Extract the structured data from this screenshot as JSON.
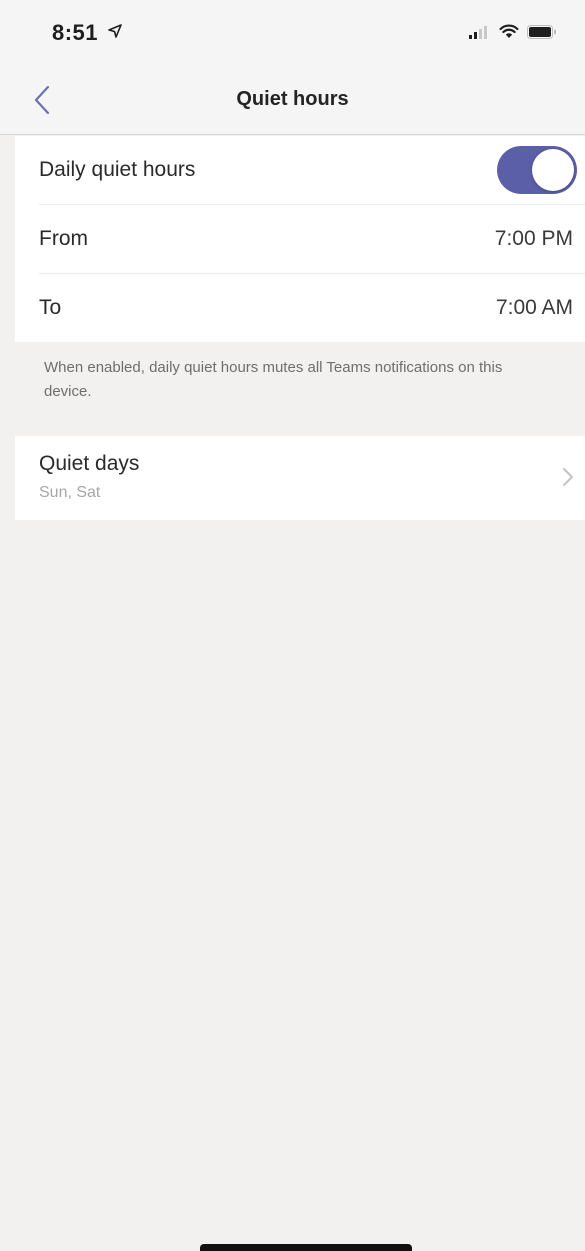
{
  "status_bar": {
    "time": "8:51"
  },
  "nav": {
    "title": "Quiet hours"
  },
  "quiet_hours": {
    "daily_label": "Daily quiet hours",
    "daily_enabled": true,
    "from_label": "From",
    "from_value": "7:00 PM",
    "to_label": "To",
    "to_value": "7:00 AM"
  },
  "footnote": "When enabled, daily quiet hours mutes all Teams notifications on this device.",
  "quiet_days": {
    "title": "Quiet days",
    "value": "Sun, Sat"
  },
  "colors": {
    "accent": "#5b5fa8",
    "background": "#f2f1f0"
  }
}
